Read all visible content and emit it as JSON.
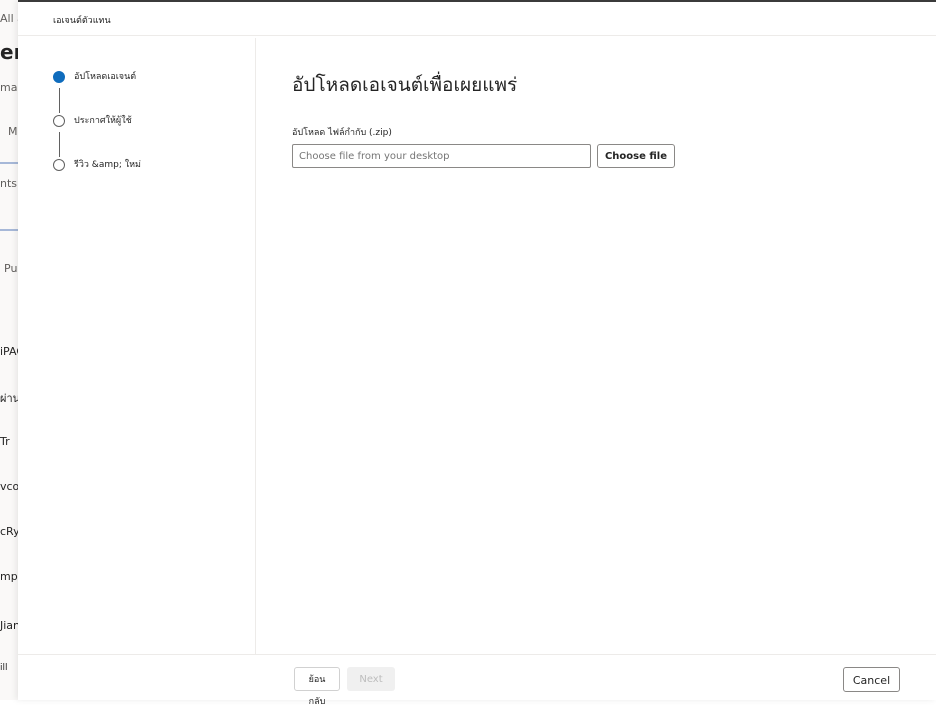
{
  "background": {
    "texts": [
      "All a",
      "er",
      "ma",
      "M",
      "nts (",
      "Pub",
      "iPAQ",
      "ผ่านตาทดสอบ",
      "Tr",
      "vcor",
      "cRys",
      "mpla",
      "Jian",
      "ill"
    ]
  },
  "panel": {
    "title": "เอเจนต์ตัวแทน"
  },
  "steps": [
    {
      "label": "อัปโหลดเอเจนต์",
      "state": "active"
    },
    {
      "label": "ประกาศให้ผู้ใช้",
      "state": "pending"
    },
    {
      "label": "รีวิว &amp; ใหม่",
      "state": "pending"
    }
  ],
  "content": {
    "title": "อัปโหลดเอเจนต์เพื่อเผยแพร่",
    "upload_label": "อัปโหลด ไฟล์กำกับ (.zip)",
    "file_placeholder": "Choose file from your desktop",
    "choose_file_label": "Choose file"
  },
  "footer": {
    "back_label": "ย้อนกลับ",
    "next_label": "Next",
    "cancel_label": "Cancel"
  },
  "colors": {
    "accent": "#0f6cbd",
    "step_inactive": "#616161"
  },
  "icons": {
    "active_step": "filled-circle-icon",
    "pending_step": "empty-circle-icon"
  }
}
